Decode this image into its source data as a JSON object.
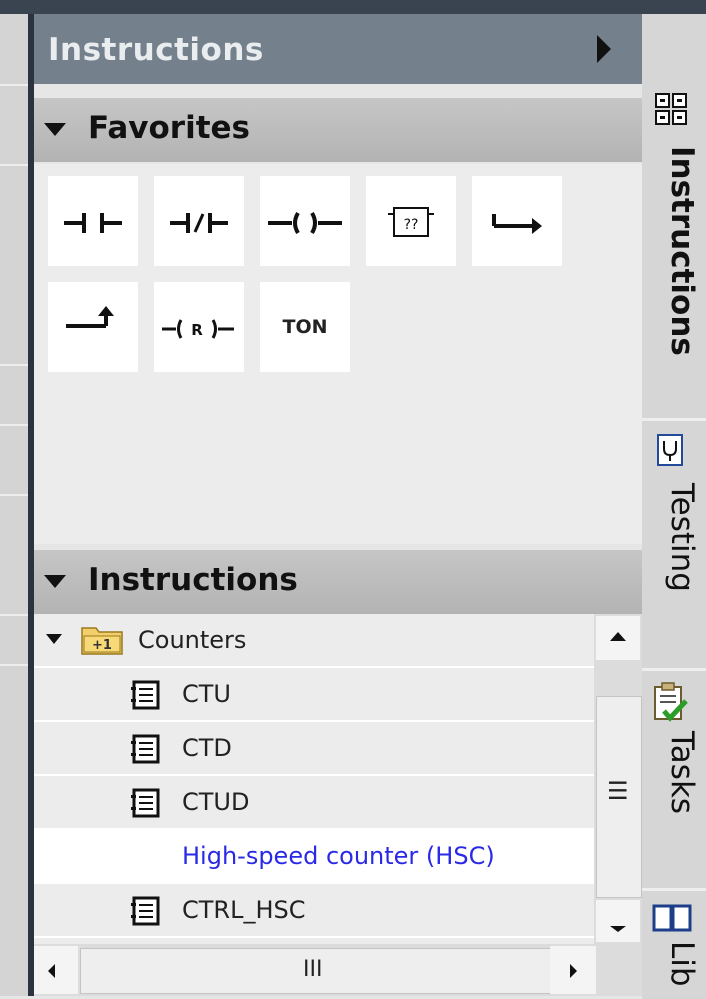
{
  "panel": {
    "title": "Instructions"
  },
  "favorites": {
    "label": "Favorites",
    "items": [
      {
        "icon": "normally-open-contact-icon"
      },
      {
        "icon": "normally-closed-contact-icon"
      },
      {
        "icon": "output-coil-icon"
      },
      {
        "icon": "empty-box-icon",
        "text": "??"
      },
      {
        "icon": "open-branch-icon"
      },
      {
        "icon": "close-branch-icon"
      },
      {
        "icon": "reset-coil-icon",
        "text": "R"
      },
      {
        "icon": "ton-timer-icon",
        "text": "TON"
      }
    ]
  },
  "instructions": {
    "label": "Instructions",
    "folder": {
      "label": "Counters",
      "badge": "+1"
    },
    "items": [
      {
        "label": "CTU"
      },
      {
        "label": "CTD"
      },
      {
        "label": "CTUD"
      },
      {
        "label": "High-speed counter (HSC)"
      },
      {
        "label": "CTRL_HSC"
      }
    ]
  },
  "scrollbar": {
    "thumb_glyph": "☰",
    "hthumb_glyph": "III"
  },
  "right_tabs": [
    {
      "label": "Instructions",
      "icon": "grid-icon"
    },
    {
      "label": "Testing",
      "icon": "testing-icon"
    },
    {
      "label": "Tasks",
      "icon": "tasks-icon"
    },
    {
      "label": "Lib",
      "icon": "libraries-icon"
    }
  ]
}
